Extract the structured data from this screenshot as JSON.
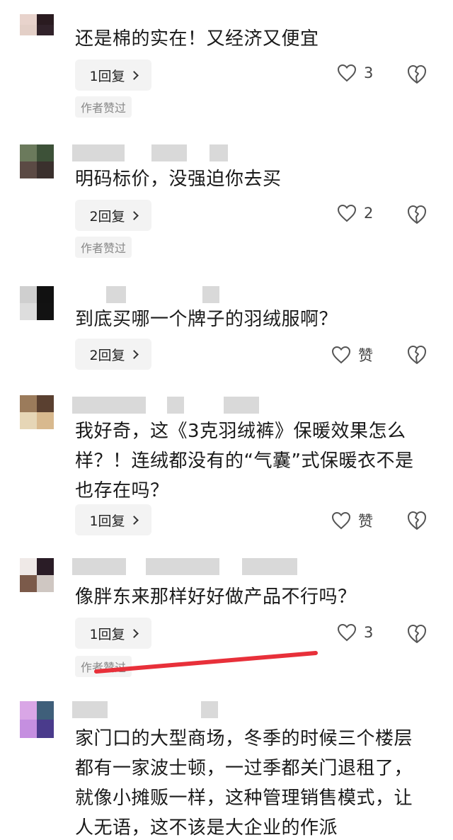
{
  "comments": [
    {
      "text": "还是棉的实在！又经济又便宜",
      "reply_label": "1回复",
      "like_label": "3",
      "author_tag": "作者赞过",
      "avatar_colors": [
        "#e8d3cc",
        "#2a1b20",
        "#e3cfc7",
        "#31222a"
      ]
    },
    {
      "text": "明码标价，没强迫你去买",
      "reply_label": "2回复",
      "like_label": "2",
      "author_tag": "作者赞过",
      "avatar_colors": [
        "#6b7a5c",
        "#3d5138",
        "#5b4a44",
        "#3a302d"
      ]
    },
    {
      "text": "到底买哪一个牌子的羽绒服啊？",
      "reply_label": "2回复",
      "like_label": "赞",
      "avatar_colors": [
        "#cfcfcf",
        "#111111",
        "#dddddd",
        "#121212"
      ]
    },
    {
      "text": "我好奇，这《3克羽绒裤》保暖效果怎么样？！连绒都没有的“气囊”式保暖衣不是也存在吗？",
      "reply_label": "1回复",
      "like_label": "赞",
      "avatar_colors": [
        "#9b7b5b",
        "#5a4030",
        "#e6d6b6",
        "#d8b98e"
      ]
    },
    {
      "text": "像胖东来那样好好做产品不行吗？",
      "reply_label": "1回复",
      "like_label": "3",
      "author_tag": "作者赞过",
      "avatar_colors": [
        "#efe9e7",
        "#2a1c26",
        "#7b5a4a",
        "#cfc7c2"
      ]
    },
    {
      "text": "家门口的大型商场，冬季的时候三个楼层都有一家波士顿，一过季都关门退租了，就像小摊贩一样，这种管理销售模式，让人无语，这不该是大企业的作派",
      "avatar_colors": [
        "#d9a6e6",
        "#3f5f7a",
        "#c58fe0",
        "#4a3b8c"
      ]
    }
  ],
  "colors": {
    "annotation_line": "#e8303a"
  },
  "icons": {
    "like": "heart-outline-icon",
    "dislike": "broken-heart-icon",
    "reply_chevron": "chevron-right-icon"
  }
}
